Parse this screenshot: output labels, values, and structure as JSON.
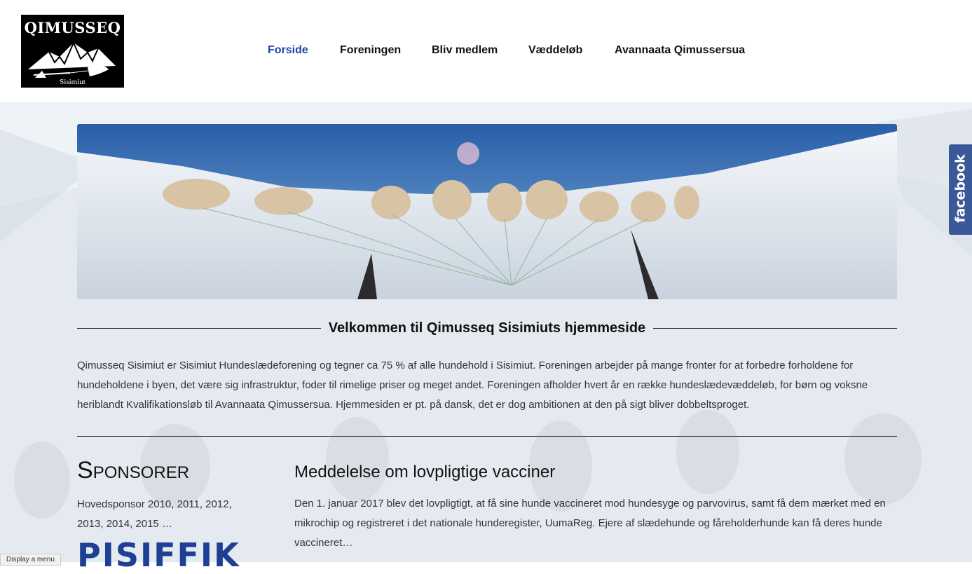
{
  "logo": {
    "title": "QIMUSSEQ",
    "subtitle": "Sisimiut"
  },
  "nav": [
    {
      "label": "Forside",
      "active": true
    },
    {
      "label": "Foreningen",
      "active": false
    },
    {
      "label": "Bliv medlem",
      "active": false
    },
    {
      "label": "Væddeløb",
      "active": false
    },
    {
      "label": "Avannaata Qimussersua",
      "active": false
    }
  ],
  "welcome": {
    "heading": "Velkommen til Qimusseq Sisimiuts hjemmeside",
    "text": "Qimusseq Sisimiut er Sisimiut Hundeslædeforening og tegner ca 75 % af alle hundehold i Sisimiut. Foreningen arbejder på mange fronter for at forbedre forholdene for hundeholdene i byen, det være sig infrastruktur, foder til rimelige priser og meget andet. Foreningen afholder hvert år en række hundeslædevæddeløb, for børn og voksne heriblandt Kvalifikationsløb til Avannaata Qimussersua. Hjemmesiden er pt. på dansk, det er dog ambitionen at den på sigt bliver dobbeltsproget."
  },
  "sponsors": {
    "title_first": "S",
    "title_rest": "PONSORER",
    "text": "Hovedsponsor 2010, 2011, 2012, 2013, 2014, 2015 …",
    "logo_text": "PISIFFIK"
  },
  "article": {
    "title": "Meddelelse om lovpligtige vacciner",
    "text": "Den 1. januar 2017 blev det lovpligtigt, at få sine hunde vaccineret mod hundesyge og parvovirus, samt få dem mærket med en mikrochip og registreret i det nationale hunderegister, UumaReg. Ejere af slædehunde og fåreholderhunde kan få deres hunde vaccineret…"
  },
  "facebook": {
    "label": "facebook"
  },
  "display_menu": {
    "label": "Display a menu"
  },
  "colors": {
    "nav_active": "#1e44a8",
    "facebook": "#3b5998",
    "sponsor_logo": "#1d3f94"
  }
}
